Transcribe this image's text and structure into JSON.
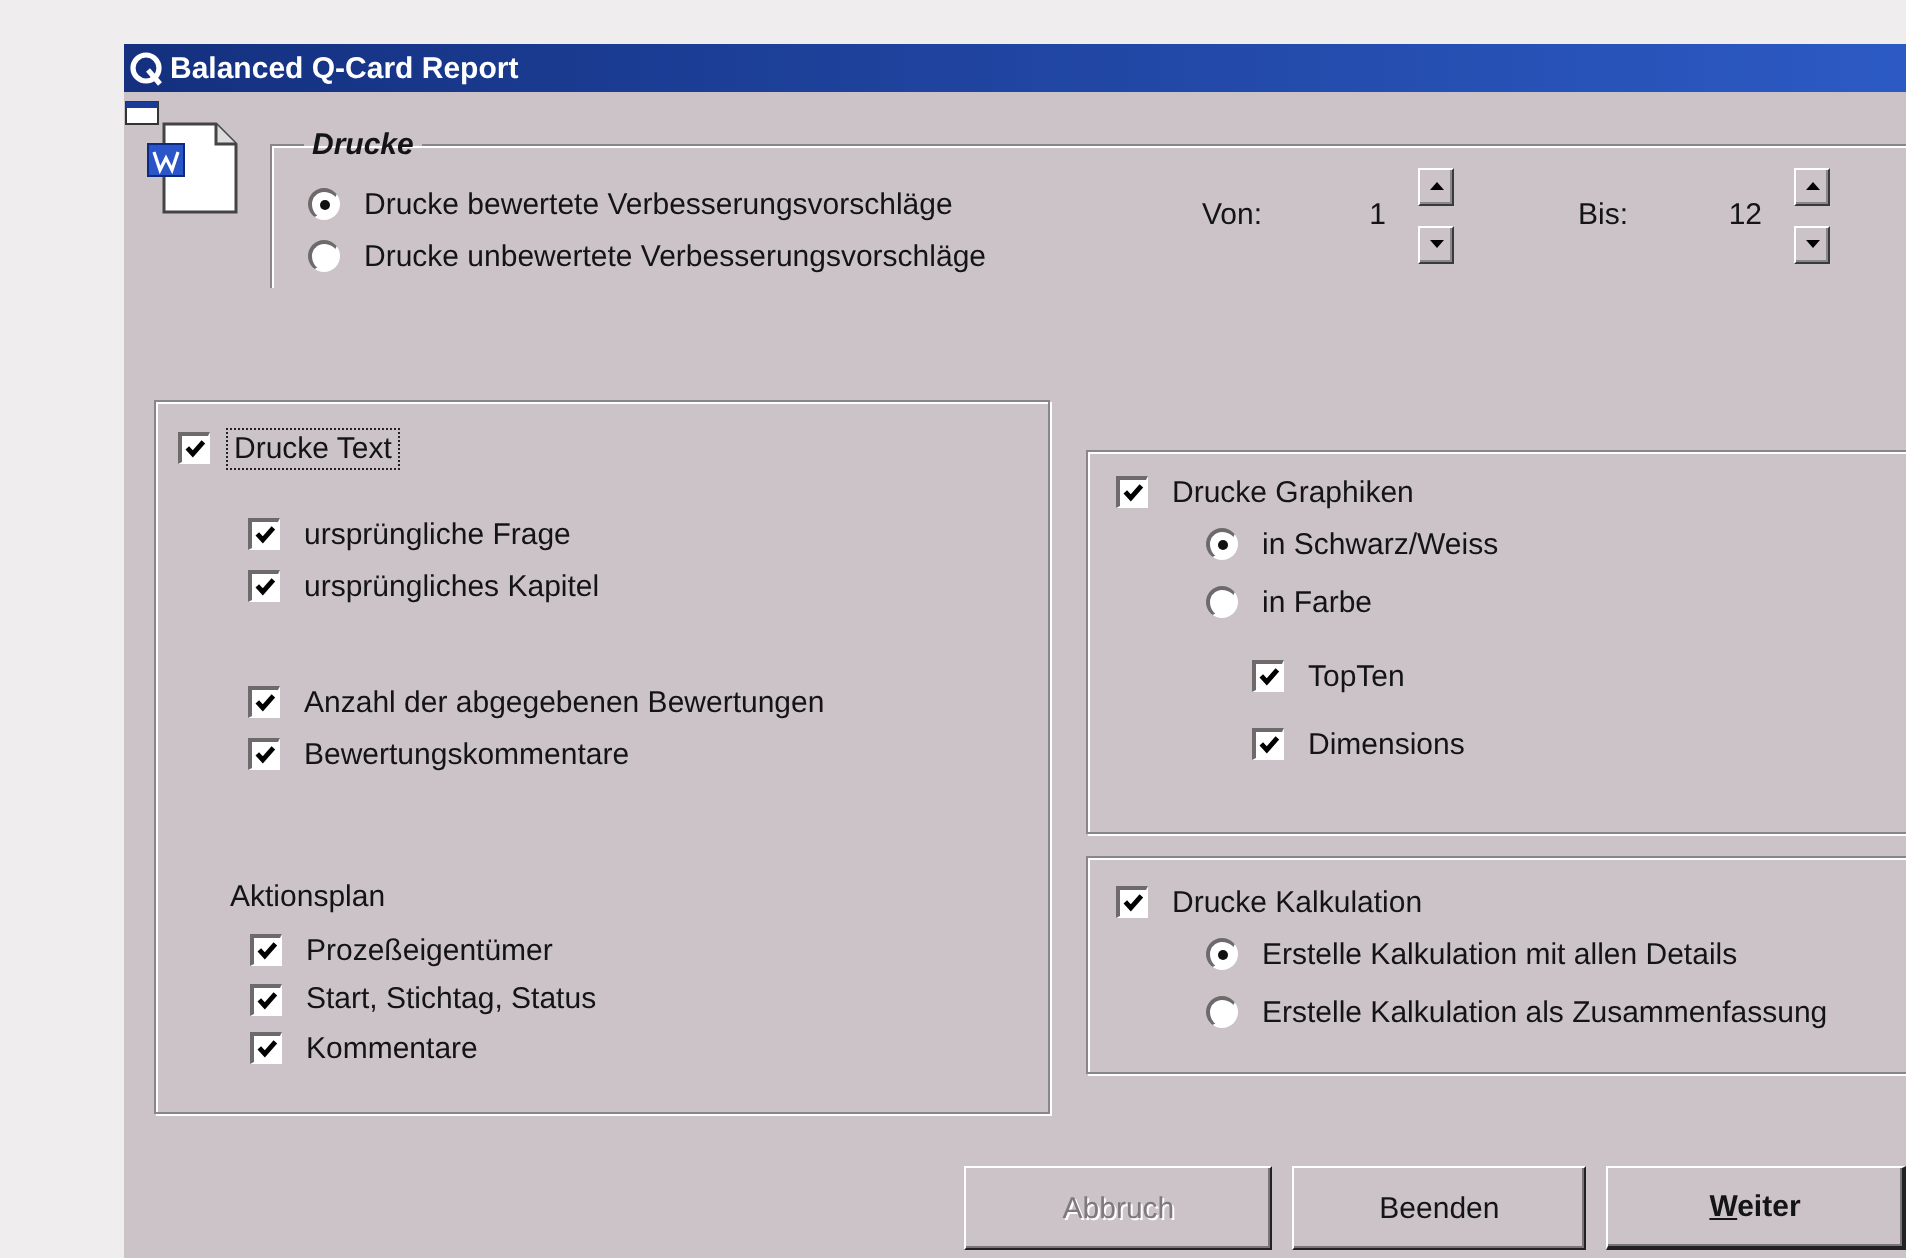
{
  "window": {
    "title": "Balanced Q-Card Report"
  },
  "print_scope": {
    "title": "Drucke",
    "options": [
      {
        "label": "Drucke bewertete Verbesserungsvorschläge",
        "selected": true
      },
      {
        "label": "Drucke unbewertete Verbesserungsvorschläge",
        "selected": false
      }
    ],
    "range": [
      {
        "label": "Von:",
        "value": "1"
      },
      {
        "label": "Bis:",
        "value": "12"
      }
    ]
  },
  "text_section": {
    "label": "Drucke Text",
    "checked": true,
    "focused": true,
    "item_groups": [
      {
        "items": [
          {
            "label": "ursprüngliche Frage",
            "checked": true
          },
          {
            "label": "ursprüngliches Kapitel",
            "checked": true
          }
        ]
      },
      {
        "items": [
          {
            "label": "Anzahl der abgegebenen Bewertungen",
            "checked": true
          },
          {
            "label": "Bewertungskommentare",
            "checked": true
          }
        ]
      }
    ],
    "action_plan": {
      "label": "Aktionsplan",
      "items": [
        {
          "label": "Prozeßeigentümer",
          "checked": true
        },
        {
          "label": "Start, Stichtag, Status",
          "checked": true
        },
        {
          "label": "Kommentare",
          "checked": true
        }
      ]
    }
  },
  "graphics_section": {
    "label": "Drucke Graphiken",
    "checked": true,
    "options": [
      {
        "label": "in Schwarz/Weiss",
        "selected": true
      },
      {
        "label": "in Farbe",
        "selected": false
      }
    ],
    "sub_options": [
      {
        "label": "TopTen",
        "checked": true
      },
      {
        "label": "Dimensions",
        "checked": true
      }
    ]
  },
  "calculation_section": {
    "label": "Drucke Kalkulation",
    "checked": true,
    "options": [
      {
        "label": "Erstelle Kalkulation mit allen Details",
        "selected": true
      },
      {
        "label": "Erstelle Kalkulation als Zusammenfassung",
        "selected": false
      }
    ]
  },
  "buttons": [
    {
      "label": "Abbruch",
      "disabled": true,
      "default": false,
      "underline_first": false
    },
    {
      "label": "Beenden",
      "disabled": false,
      "default": false,
      "underline_first": false
    },
    {
      "label": "Weiter",
      "disabled": false,
      "default": true,
      "underline_first": true
    }
  ]
}
